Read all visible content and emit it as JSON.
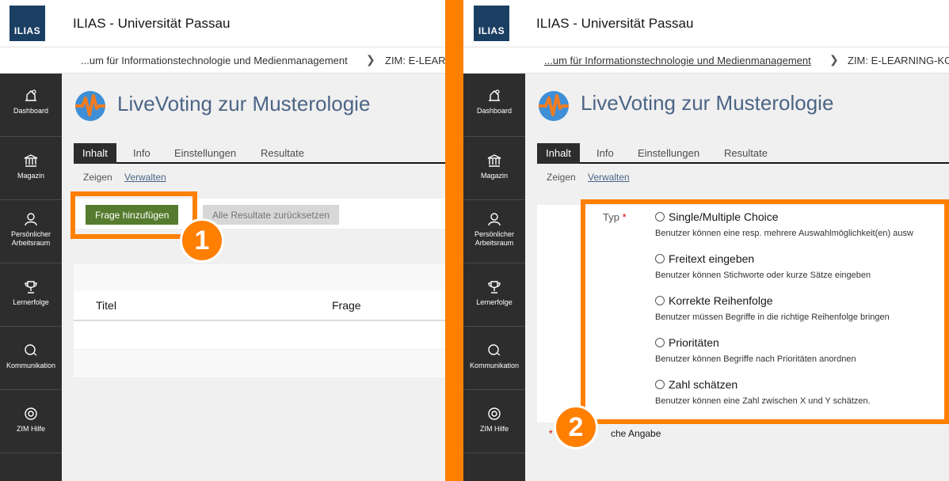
{
  "left": {
    "logo": "ILIAS",
    "app_title": "ILIAS - Universität Passau",
    "breadcrumb": {
      "first": "...um für Informationstechnologie und Medienmanagement",
      "second": "ZIM: E-LEARN"
    },
    "sidebar": [
      {
        "label": "Dashboard",
        "icon": "dashboard-icon"
      },
      {
        "label": "Magazin",
        "icon": "bank-icon"
      },
      {
        "label": "Persönlicher Arbeitsraum",
        "icon": "user-icon"
      },
      {
        "label": "Lernerfolge",
        "icon": "trophy-icon"
      },
      {
        "label": "Kommunikation",
        "icon": "chat-icon"
      },
      {
        "label": "ZIM Hilfe",
        "icon": "lifebuoy-icon"
      }
    ],
    "page_title": "LiveVoting zur Musterologie",
    "tabs": [
      "Inhalt",
      "Info",
      "Einstellungen",
      "Resultate"
    ],
    "subtabs": [
      "Zeigen",
      "Verwalten"
    ],
    "buttons": {
      "add_question": "Frage hinzufügen",
      "reset_results": "Alle Resultate zurücksetzen"
    },
    "table": {
      "headers": [
        "Titel",
        "Frage"
      ]
    },
    "badge": "1"
  },
  "right": {
    "logo": "ILIAS",
    "app_title": "ILIAS - Universität Passau",
    "breadcrumb": {
      "first": "...um für Informationstechnologie und Medienmanagement",
      "second": "ZIM: E-LEARNING-KOM"
    },
    "sidebar": [
      {
        "label": "Dashboard",
        "icon": "dashboard-icon"
      },
      {
        "label": "Magazin",
        "icon": "bank-icon"
      },
      {
        "label": "Persönlicher Arbeitsraum",
        "icon": "user-icon"
      },
      {
        "label": "Lernerfolge",
        "icon": "trophy-icon"
      },
      {
        "label": "Kommunikation",
        "icon": "chat-icon"
      },
      {
        "label": "ZIM Hilfe",
        "icon": "lifebuoy-icon"
      }
    ],
    "page_title": "LiveVoting zur Musterologie",
    "tabs": [
      "Inhalt",
      "Info",
      "Einstellungen",
      "Resultate"
    ],
    "subtabs": [
      "Zeigen",
      "Verwalten"
    ],
    "form": {
      "type_label": "Typ",
      "required_mark": "*",
      "options": [
        {
          "label": "Single/Multiple Choice",
          "desc": "Benutzer können eine resp. mehrere Auswahlmöglichkeit(en) ausw"
        },
        {
          "label": "Freitext eingeben",
          "desc": "Benutzer können Stichworte oder kurze Sätze eingeben"
        },
        {
          "label": "Korrekte Reihenfolge",
          "desc": "Benutzer müssen Begriffe in die richtige Reihenfolge bringen"
        },
        {
          "label": "Prioritäten",
          "desc": "Benutzer können Begriffe nach Prioritäten anordnen"
        },
        {
          "label": "Zahl schätzen",
          "desc": "Benutzer können eine Zahl zwischen X und Y schätzen."
        }
      ],
      "required_note": "che Angabe"
    },
    "badge": "2"
  },
  "colors": {
    "highlight": "#ff7f00",
    "sidebar": "#2d2d2d",
    "primary_button": "#557b2e",
    "title": "#4c6586"
  }
}
